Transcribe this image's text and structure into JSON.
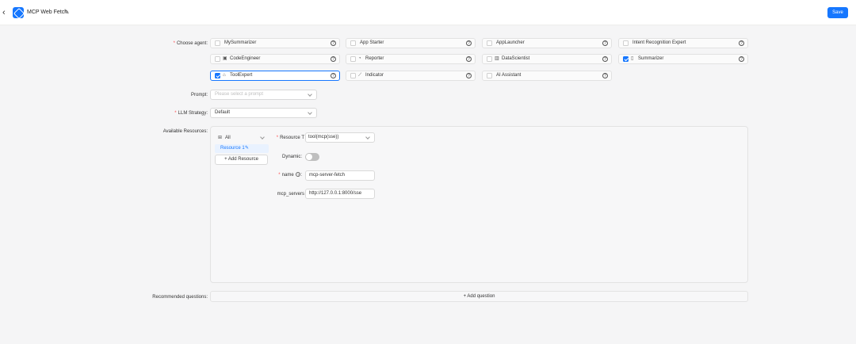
{
  "header": {
    "back_icon": "‹",
    "app_title": "MCP Web Fetch",
    "edit_icon": "✎",
    "save_label": "Save"
  },
  "form": {
    "agent_label": "Choose agent",
    "prompt_label": "Prompt",
    "prompt_placeholder": "Please select a prompt",
    "llm_label": "LLM Strategy",
    "llm_value": "Default",
    "resources_label": "Available Resources",
    "recommended_label": "Recommended questions",
    "colon": ":"
  },
  "agents": [
    {
      "name": "MySummarizer",
      "icon": "",
      "checked": false,
      "selected": false
    },
    {
      "name": "App Starter",
      "icon": "",
      "checked": false,
      "selected": false
    },
    {
      "name": "AppLauncher",
      "icon": "",
      "checked": false,
      "selected": false
    },
    {
      "name": "Intent Recognition Expert",
      "icon": "",
      "checked": false,
      "selected": false
    },
    {
      "name": "CodeEngineer",
      "icon": "▣",
      "checked": false,
      "selected": false
    },
    {
      "name": "Reporter",
      "icon": "◔",
      "checked": false,
      "selected": false
    },
    {
      "name": "DataScientist",
      "icon": "▥",
      "checked": false,
      "selected": false
    },
    {
      "name": "Summarizer",
      "icon": "▯",
      "checked": true,
      "selected": false
    },
    {
      "name": "ToolExpert",
      "icon": "⌂",
      "checked": true,
      "selected": true
    },
    {
      "name": "Indicator",
      "icon": "⟋",
      "checked": false,
      "selected": false
    },
    {
      "name": "AI Assistant",
      "icon": "",
      "checked": false,
      "selected": false
    }
  ],
  "agent_help_icon": "?",
  "resources": {
    "filter_icon": "⊞",
    "filter_value": "All",
    "items": [
      {
        "label": "Resource 1",
        "edit_icon": "✎"
      }
    ],
    "add_label": "+ Add Resource",
    "type_label": "Resource T",
    "type_value": "tool(mcp(sse))",
    "dynamic_label": "Dynamic",
    "dynamic_on": false,
    "name_label": "name",
    "name_help": "?",
    "name_value": "mcp-server-fetch",
    "servers_label": "mcp_servers",
    "servers_value": "http://127.0.0.1:8000/sse"
  },
  "questions": {
    "add_label": "+ Add question"
  },
  "colors": {
    "primary": "#1677ff",
    "required": "#ff4d4f",
    "background": "#f5f5f6"
  }
}
